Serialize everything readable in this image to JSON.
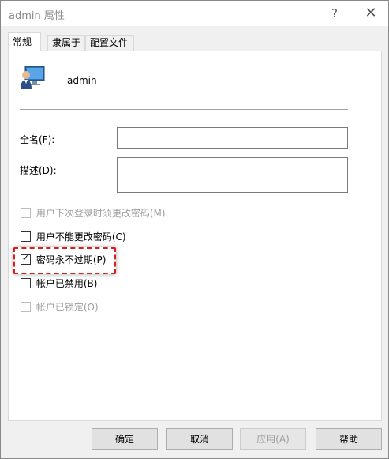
{
  "window": {
    "title": "admin 属性",
    "help_glyph": "?",
    "close_glyph": "✕"
  },
  "tabs": [
    {
      "label": "常规",
      "active": true
    },
    {
      "label": "隶属于",
      "active": false
    },
    {
      "label": "配置文件",
      "active": false
    }
  ],
  "user": {
    "name": "admin",
    "icon": "user-monitor-icon"
  },
  "fields": {
    "fullname_label": "全名(F):",
    "fullname_value": "",
    "description_label": "描述(D):",
    "description_value": ""
  },
  "checkboxes": [
    {
      "label": "用户下次登录时须更改密码(M)",
      "checked": false,
      "disabled": true
    },
    {
      "label": "用户不能更改密码(C)",
      "checked": false,
      "disabled": false
    },
    {
      "label": "密码永不过期(P)",
      "checked": true,
      "disabled": false
    },
    {
      "label": "帐户已禁用(B)",
      "checked": false,
      "disabled": false
    },
    {
      "label": "帐户已锁定(O)",
      "checked": false,
      "disabled": true
    }
  ],
  "buttons": {
    "ok": "确定",
    "cancel": "取消",
    "apply": "应用(A)",
    "help": "帮助"
  },
  "colors": {
    "highlight": "#d42020",
    "disabled_text": "#9e9e9e"
  }
}
